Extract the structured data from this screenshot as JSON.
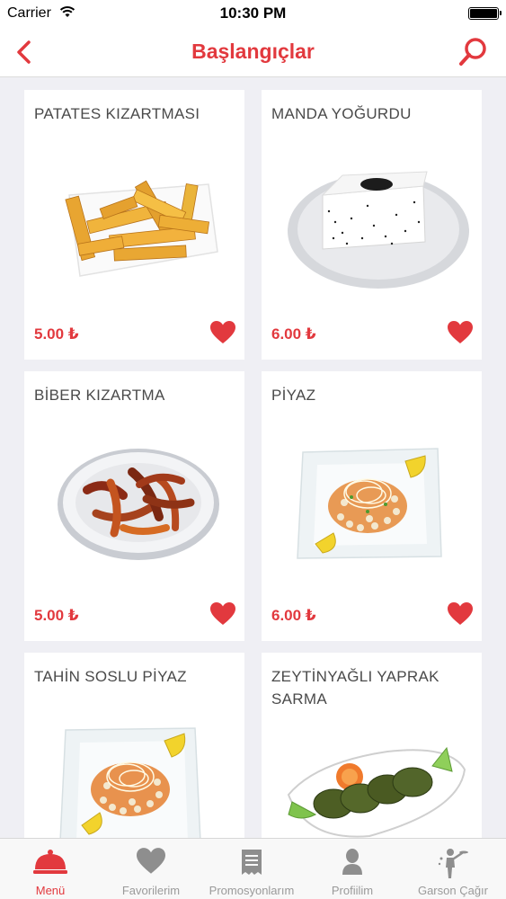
{
  "status_bar": {
    "carrier": "Carrier",
    "time": "10:30 PM"
  },
  "nav": {
    "title": "Başlangıçlar",
    "back_icon": "chevron-left-icon",
    "search_icon": "search-icon"
  },
  "colors": {
    "accent": "#e2393e",
    "text": "#4a4a4a",
    "background": "#efeff4",
    "tab_inactive": "#9a9a9a"
  },
  "items": [
    {
      "name": "PATATES KIZARTMASI",
      "price": "5.00 ₺",
      "image": "french-fries-photo"
    },
    {
      "name": "MANDA YOĞURDU",
      "price": "6.00 ₺",
      "image": "buffalo-yogurt-photo"
    },
    {
      "name": "BİBER KIZARTMA",
      "price": "5.00 ₺",
      "image": "fried-peppers-photo"
    },
    {
      "name": "PİYAZ",
      "price": "6.00 ₺",
      "image": "piyaz-salad-photo"
    },
    {
      "name": "TAHİN SOSLU PİYAZ",
      "price": "",
      "image": "tahini-piyaz-photo"
    },
    {
      "name": "ZEYTİNYAĞLI YAPRAK SARMA",
      "price": "",
      "image": "stuffed-grape-leaves-photo"
    }
  ],
  "tabs": [
    {
      "label": "Menü",
      "icon": "cloche-icon",
      "active": true
    },
    {
      "label": "Favorilerim",
      "icon": "heart-icon",
      "active": false
    },
    {
      "label": "Promosyonlarım",
      "icon": "receipt-icon",
      "active": false
    },
    {
      "label": "Profiilim",
      "icon": "user-icon",
      "active": false
    },
    {
      "label": "Garson Çağır",
      "icon": "waiter-icon",
      "active": false
    }
  ]
}
